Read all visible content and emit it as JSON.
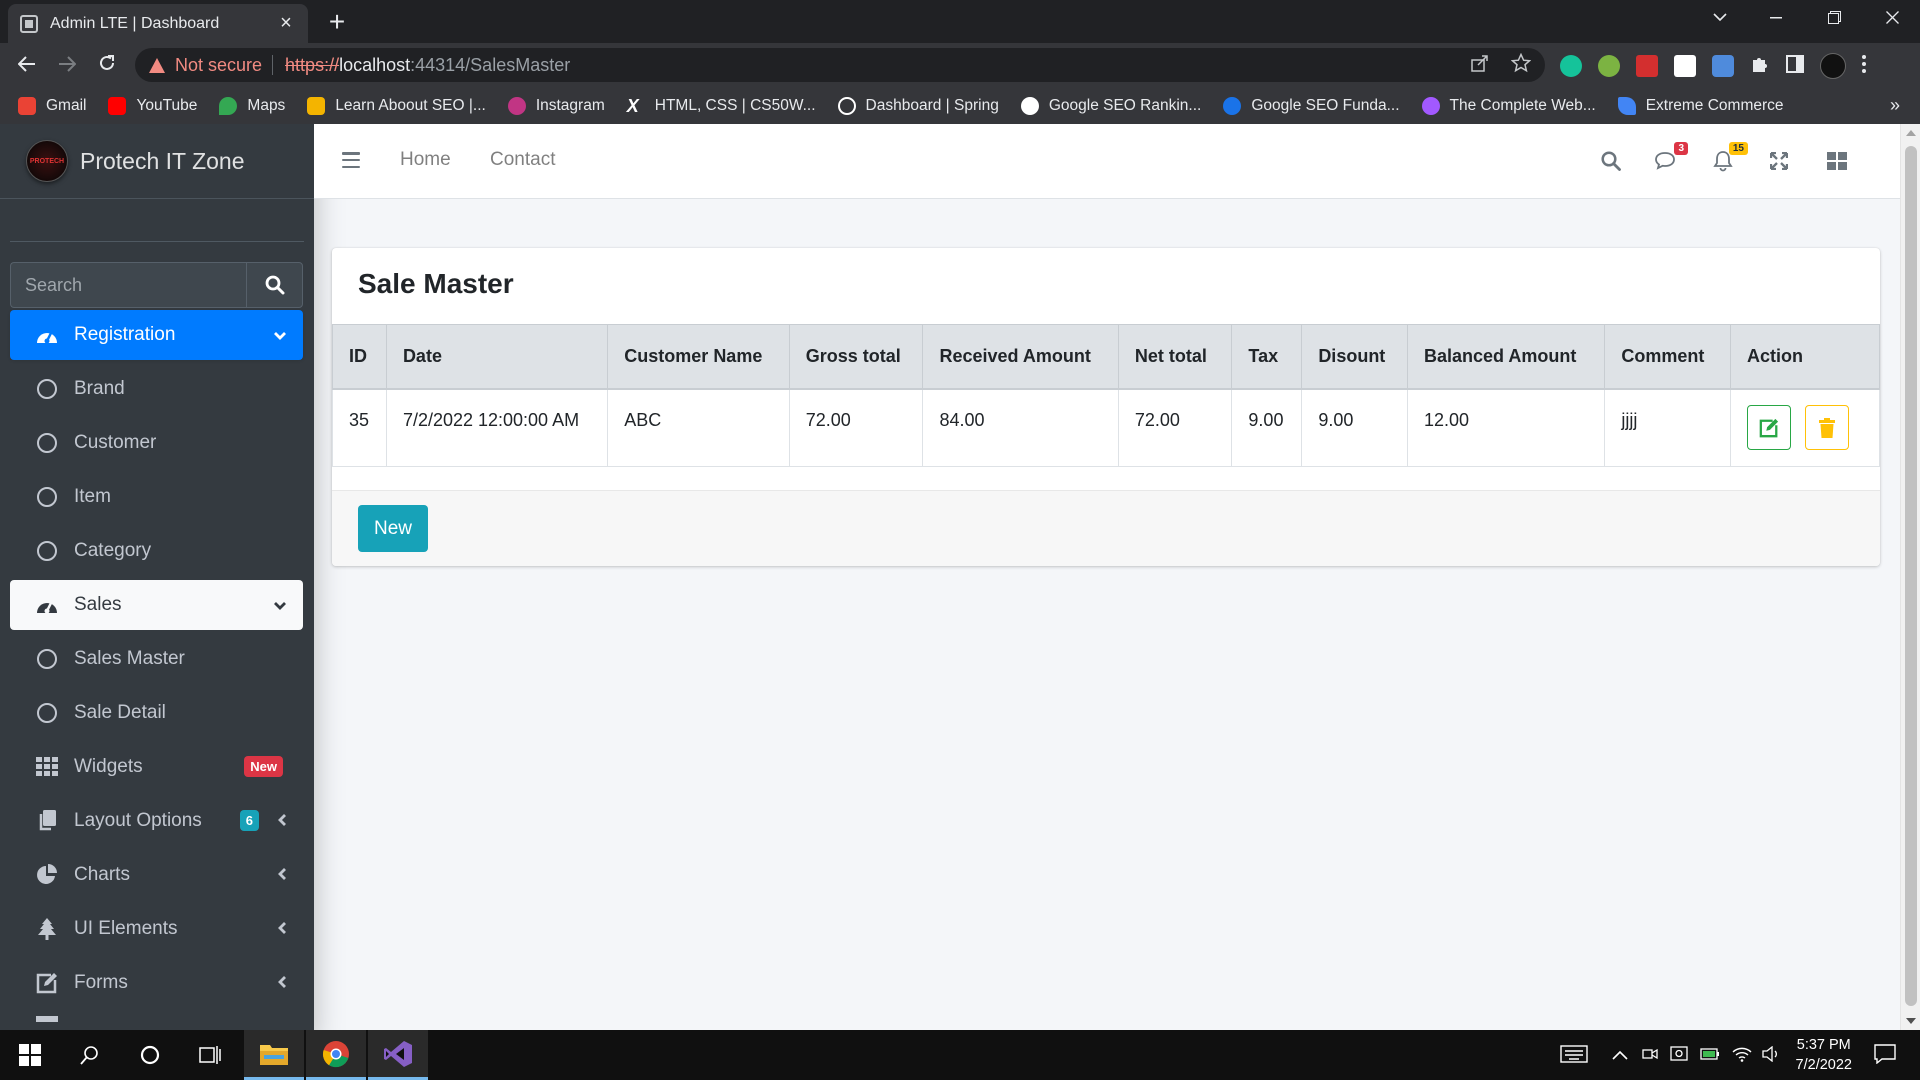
{
  "browser": {
    "tab_title": "Admin LTE | Dashboard",
    "tab_close": "×",
    "new_tab": "+",
    "security_text": "Not secure",
    "url_scheme": "https://",
    "url_host": "localhost",
    "url_rest": ":44314/SalesMaster",
    "bookmarks": [
      {
        "label": "Gmail",
        "color": "#ea4335"
      },
      {
        "label": "YouTube",
        "color": "#ff0000"
      },
      {
        "label": "Maps",
        "color": "#34a853"
      },
      {
        "label": "Learn Aboout SEO |...",
        "color": "#f4b400"
      },
      {
        "label": "Instagram",
        "color": "#c13584"
      },
      {
        "label": "HTML, CSS | CS50W...",
        "color": "#ffffff"
      },
      {
        "label": "Dashboard | Spring",
        "color": "#ffffff"
      },
      {
        "label": "Google SEO Rankin...",
        "color": "#ffffff"
      },
      {
        "label": "Google SEO Funda...",
        "color": "#1a73e8"
      },
      {
        "label": "The Complete Web...",
        "color": "#a259ff"
      },
      {
        "label": "Extreme Commerce",
        "color": "#4285f4"
      }
    ],
    "bookmarks_more": "»"
  },
  "sidebar": {
    "brand": "Protech IT Zone",
    "logo_text": "PROTECH",
    "search_placeholder": "Search",
    "items": [
      {
        "label": "Registration",
        "icon": "tachometer-icon"
      },
      {
        "label": "Brand",
        "icon": "circle-icon"
      },
      {
        "label": "Customer",
        "icon": "circle-icon"
      },
      {
        "label": "Item",
        "icon": "circle-icon"
      },
      {
        "label": "Category",
        "icon": "circle-icon"
      },
      {
        "label": "Sales",
        "icon": "tachometer-icon"
      },
      {
        "label": "Sales Master",
        "icon": "circle-icon"
      },
      {
        "label": "Sale Detail",
        "icon": "circle-icon"
      },
      {
        "label": "Widgets",
        "icon": "grid-icon",
        "badge": "New"
      },
      {
        "label": "Layout Options",
        "icon": "copy-icon",
        "badge": "6"
      },
      {
        "label": "Charts",
        "icon": "pie-chart-icon"
      },
      {
        "label": "UI Elements",
        "icon": "tree-icon"
      },
      {
        "label": "Forms",
        "icon": "edit-icon"
      }
    ]
  },
  "topnav": {
    "home": "Home",
    "contact": "Contact",
    "messages_count": "3",
    "notifications_count": "15"
  },
  "card": {
    "title": "Sale Master",
    "columns": [
      "ID",
      "Date",
      "Customer Name",
      "Gross total",
      "Received Amount",
      "Net total",
      "Tax",
      "Disount",
      "Balanced Amount",
      "Comment",
      "Action"
    ],
    "rows": [
      {
        "id": "35",
        "date": "7/2/2022 12:00:00 AM",
        "customer": "ABC",
        "gross": "72.00",
        "received": "84.00",
        "net": "72.00",
        "tax": "9.00",
        "discount": "9.00",
        "balanced": "12.00",
        "comment": "jjjj"
      }
    ],
    "new_button": "New"
  },
  "taskbar": {
    "time": "5:37 PM",
    "date": "7/2/2022"
  },
  "colors": {
    "sidebar_bg": "#343a40",
    "primary": "#007bff",
    "info": "#17a2b8",
    "success": "#28a745",
    "warning": "#ffc107",
    "danger": "#dc3545"
  }
}
